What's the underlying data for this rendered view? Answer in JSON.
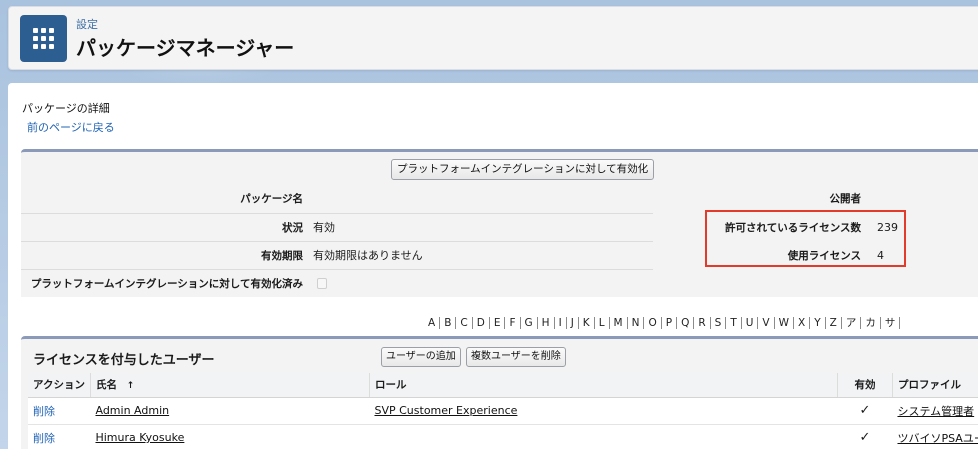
{
  "header": {
    "breadcrumb": "設定",
    "title": "パッケージマネージャー"
  },
  "detail": {
    "section_label": "パッケージの詳細",
    "back_link": "前のページに戻る",
    "enable_button": "プラットフォームインテグレーションに対して有効化",
    "package_name_label": "パッケージ名",
    "package_name_value": "",
    "publisher_label": "公開者",
    "publisher_value": "",
    "status_label": "状況",
    "status_value": "有効",
    "licensed_label": "許可されているライセンス数",
    "licensed_value": "239",
    "expiration_label": "有効期限",
    "expiration_value": "有効期限はありません",
    "used_label": "使用ライセンス",
    "used_value": "4",
    "platform_enabled_label": "プラットフォームインテグレーションに対して有効化済み",
    "platform_enabled_checked": false
  },
  "alphabet": [
    "A",
    "B",
    "C",
    "D",
    "E",
    "F",
    "G",
    "H",
    "I",
    "J",
    "K",
    "L",
    "M",
    "N",
    "O",
    "P",
    "Q",
    "R",
    "S",
    "T",
    "U",
    "V",
    "W",
    "X",
    "Y",
    "Z",
    "ア",
    "カ",
    "サ"
  ],
  "users": {
    "title": "ライセンスを付与したユーザー",
    "add_button": "ユーザーの追加",
    "remove_button": "複数ユーザーを削除",
    "columns": {
      "action": "アクション",
      "name": "氏名",
      "sort_indicator": "↑",
      "role": "ロール",
      "active": "有効",
      "profile": "プロファイル"
    },
    "rows": [
      {
        "action": "削除",
        "name": "Admin Admin",
        "role": "SVP Customer Experience",
        "active": "✓",
        "profile": "システム管理者"
      },
      {
        "action": "削除",
        "name": "Himura Kyosuke",
        "role": "",
        "active": "✓",
        "profile": "ツバイソPSAユー"
      }
    ]
  },
  "colors": {
    "accent": "#2d5e92",
    "link": "#1f63b5",
    "highlight_border": "#e23b2b"
  }
}
